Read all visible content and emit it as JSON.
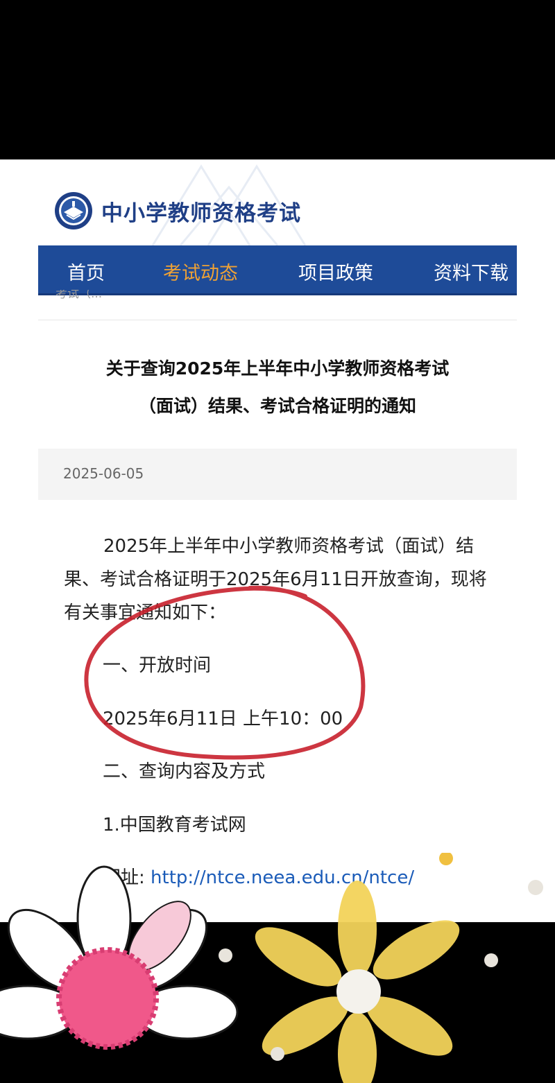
{
  "header": {
    "site_title": "中小学教师资格考试"
  },
  "nav": {
    "items": [
      {
        "label": "首页",
        "active": false
      },
      {
        "label": "考试动态",
        "active": true
      },
      {
        "label": "项目政策",
        "active": false
      },
      {
        "label": "资料下载",
        "active": false
      }
    ]
  },
  "breadcrumb": "考试（...",
  "article": {
    "title_line1": "关于查询2025年上半年中小学教师资格考试",
    "title_line2": "（面试）结果、考试合格证明的通知",
    "date": "2025-06-05",
    "intro": "2025年上半年中小学教师资格考试（面试）结果、考试合格证明于2025年6月11日开放查询，现将有关事宜通知如下：",
    "section1_heading": "一、开放时间",
    "section1_value": "2025年6月11日 上午10：00",
    "section2_heading": "二、查询内容及方式",
    "item1": "1.中国教育考试网",
    "url_label": "网址: ",
    "url": "http://ntce.neea.edu.cn/ntce/"
  },
  "colors": {
    "nav_bg": "#1e4b98",
    "nav_active": "#f0a234",
    "title_blue": "#1f3f86",
    "link": "#1a5bb8",
    "annotation_red": "#c8202c"
  },
  "icons": [
    "emblem-logo-icon",
    "red-circle-annotation",
    "pink-flower-sticker",
    "yellow-flower-sticker"
  ]
}
